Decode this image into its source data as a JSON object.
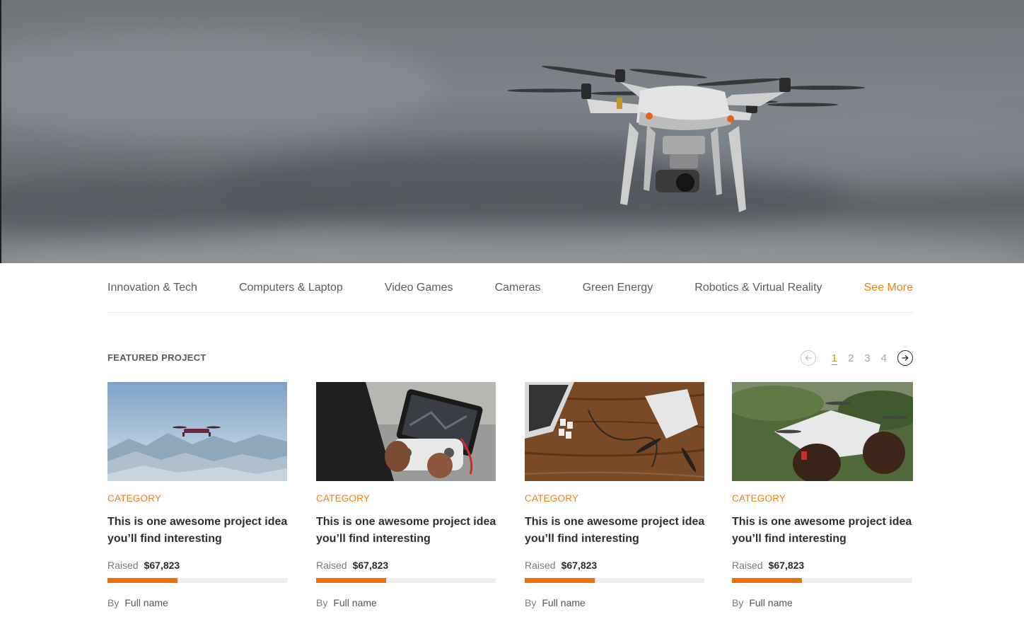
{
  "hero": {
    "image": "drone-in-sky"
  },
  "categories": [
    "Innovation & Tech",
    "Computers & Laptop",
    "Video Games",
    "Cameras",
    "Green Energy",
    "Robotics & Virtual Reality"
  ],
  "see_more_label": "See More",
  "featured": {
    "title": "FEATURED PROJECT",
    "pagination": {
      "pages": [
        "1",
        "2",
        "3",
        "4"
      ],
      "active": "1"
    }
  },
  "projects": [
    {
      "image": "drone-over-mountains",
      "category": "CATEGORY",
      "title": "This is one awesome project idea you’ll find interesting",
      "raised_label": "Raised",
      "raised": "$67,823",
      "progress": 0.39,
      "by_label": "By",
      "author": "Full name"
    },
    {
      "image": "drone-controller-tablet",
      "category": "CATEGORY",
      "title": "This is one awesome project idea you’ll find interesting",
      "raised_label": "Raised",
      "raised": "$67,823",
      "progress": 0.39,
      "by_label": "By",
      "author": "Full name"
    },
    {
      "image": "drone-laptop-on-wood",
      "category": "CATEGORY",
      "title": "This is one awesome project idea you’ll find interesting",
      "raised_label": "Raised",
      "raised": "$67,823",
      "progress": 0.39,
      "by_label": "By",
      "author": "Full name"
    },
    {
      "image": "hands-holding-drone",
      "category": "CATEGORY",
      "title": "This is one awesome project idea you’ll find interesting",
      "raised_label": "Raised",
      "raised": "$67,823",
      "progress": 0.39,
      "by_label": "By",
      "author": "Full name"
    }
  ],
  "colors": {
    "accent": "#e8831a",
    "progress": "#e8730a",
    "track": "#eeeeee"
  }
}
